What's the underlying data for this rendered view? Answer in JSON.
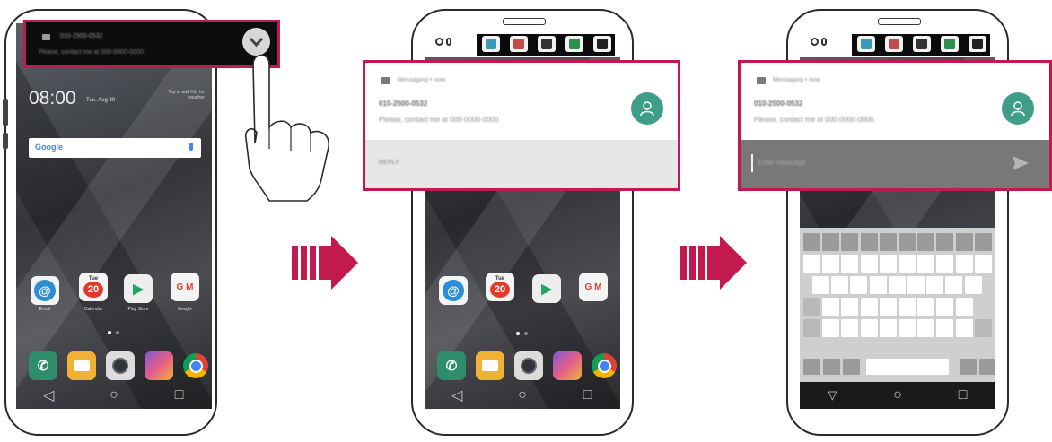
{
  "panel1": {
    "popup_number": "010-2500-0532",
    "popup_message": "Please, contact me at 000-0000-0000.",
    "clock_time": "08:00",
    "clock_date": "Tue, Aug 30",
    "weather_hint": "Tap to add City for weather",
    "search_brand": "Google",
    "apps": [
      {
        "name": "Email",
        "icon": "@"
      },
      {
        "name": "Calendar",
        "icon": "20",
        "header": "Tue"
      },
      {
        "name": "Play Store",
        "icon": "▶"
      },
      {
        "name": "Google",
        "icon": "G M"
      }
    ]
  },
  "panel2": {
    "header": "Messaging • now",
    "number": "010-2500-0532",
    "message": "Please, contact me at 000-0000-0000.",
    "reply_label": "REPLY"
  },
  "panel3": {
    "header": "Messaging • now",
    "number": "010-2500-0532",
    "message": "Please, contact me at 000-0000-0000.",
    "input_placeholder": "Enter message"
  },
  "nav": {
    "back": "◁",
    "home": "○",
    "recents": "□"
  },
  "colors": {
    "highlight": "#c21a4e",
    "avatar": "#3f9e87",
    "arrow": "#c21a4e"
  },
  "icons": [
    "message-icon",
    "close-icon",
    "mic-icon",
    "person-icon",
    "send-icon",
    "phone-icon",
    "camera-icon",
    "gallery-icon",
    "chrome-icon",
    "hand-pointer-icon"
  ]
}
